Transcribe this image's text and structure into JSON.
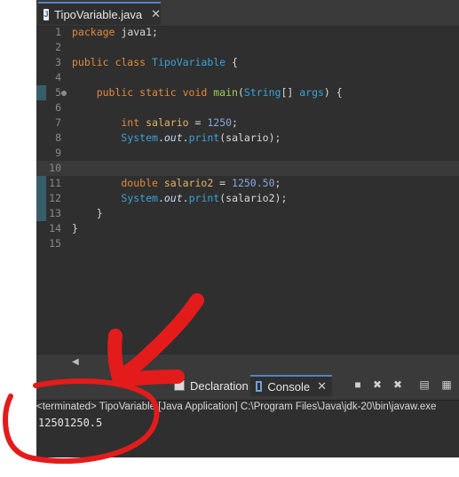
{
  "editor": {
    "tab_label": "TipoVariable.java",
    "tab_icon": "J",
    "lines": [
      {
        "n": "1",
        "tokens": [
          {
            "t": "package ",
            "c": "kw"
          },
          {
            "t": "java1;",
            "c": ""
          }
        ]
      },
      {
        "n": "2",
        "tokens": []
      },
      {
        "n": "3",
        "tokens": [
          {
            "t": "public class ",
            "c": "kw"
          },
          {
            "t": "TipoVariable",
            "c": "cls"
          },
          {
            "t": " {",
            "c": ""
          }
        ]
      },
      {
        "n": "4",
        "tokens": []
      },
      {
        "n": "5",
        "fold": true,
        "tokens": [
          {
            "t": "    public static void ",
            "c": "kw"
          },
          {
            "t": "main",
            "c": "fn"
          },
          {
            "t": "(",
            "c": ""
          },
          {
            "t": "String",
            "c": "cls"
          },
          {
            "t": "[] ",
            "c": ""
          },
          {
            "t": "args",
            "c": "cls"
          },
          {
            "t": ") {",
            "c": ""
          }
        ]
      },
      {
        "n": "6",
        "tokens": []
      },
      {
        "n": "7",
        "tokens": [
          {
            "t": "        int ",
            "c": "kw"
          },
          {
            "t": "salario",
            "c": "var"
          },
          {
            "t": " = ",
            "c": ""
          },
          {
            "t": "1250",
            "c": "num"
          },
          {
            "t": ";",
            "c": ""
          }
        ]
      },
      {
        "n": "8",
        "tokens": [
          {
            "t": "        ",
            "c": ""
          },
          {
            "t": "System",
            "c": "cls"
          },
          {
            "t": ".",
            "c": ""
          },
          {
            "t": "out",
            "c": "fld"
          },
          {
            "t": ".",
            "c": ""
          },
          {
            "t": "print",
            "c": "cls"
          },
          {
            "t": "(salario);",
            "c": ""
          }
        ]
      },
      {
        "n": "9",
        "tokens": []
      },
      {
        "n": "10",
        "hl": true,
        "tokens": []
      },
      {
        "n": "11",
        "tokens": [
          {
            "t": "        double ",
            "c": "kw"
          },
          {
            "t": "salario2",
            "c": "var"
          },
          {
            "t": " = ",
            "c": ""
          },
          {
            "t": "1250.50",
            "c": "num"
          },
          {
            "t": ";",
            "c": ""
          }
        ]
      },
      {
        "n": "12",
        "tokens": [
          {
            "t": "        ",
            "c": ""
          },
          {
            "t": "System",
            "c": "cls"
          },
          {
            "t": ".",
            "c": ""
          },
          {
            "t": "out",
            "c": "fld"
          },
          {
            "t": ".",
            "c": ""
          },
          {
            "t": "print",
            "c": "cls"
          },
          {
            "t": "(salario2);",
            "c": ""
          }
        ]
      },
      {
        "n": "13",
        "tokens": [
          {
            "t": "    }",
            "c": ""
          }
        ]
      },
      {
        "n": "14",
        "tokens": [
          {
            "t": "}",
            "c": ""
          }
        ]
      },
      {
        "n": "15",
        "tokens": []
      }
    ]
  },
  "bottom": {
    "tab_declaration": "Declaration",
    "tab_console": "Console",
    "status": "<terminated> TipoVariable [Java Application] C:\\Program Files\\Java\\jdk-20\\bin\\javaw.exe",
    "output": "12501250.5"
  },
  "colors": {
    "annotation": "#e41b1b",
    "accent": "#4f84c4"
  }
}
